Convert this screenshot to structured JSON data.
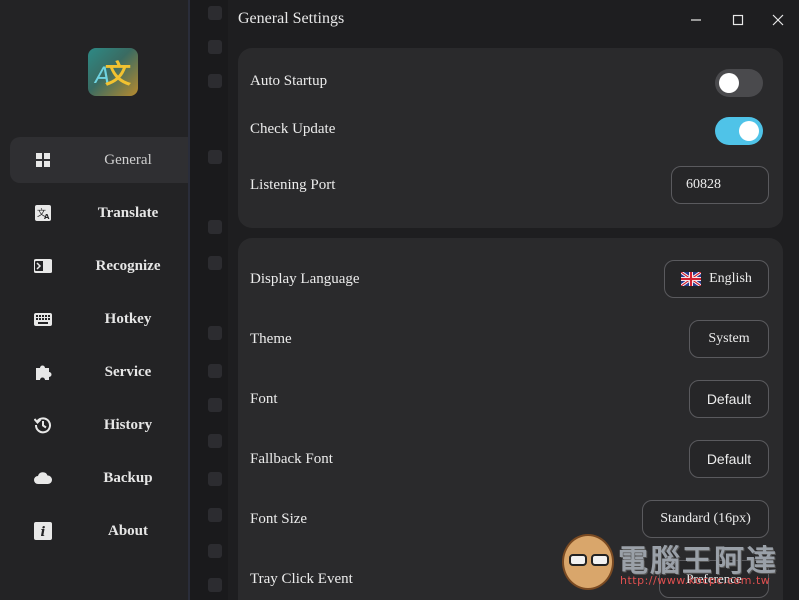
{
  "window": {
    "title": "General Settings"
  },
  "sidebar": {
    "items": [
      {
        "label": "General",
        "icon": "grid-icon",
        "active": true
      },
      {
        "label": "Translate",
        "icon": "translate-icon"
      },
      {
        "label": "Recognize",
        "icon": "recognize-icon"
      },
      {
        "label": "Hotkey",
        "icon": "keyboard-icon"
      },
      {
        "label": "Service",
        "icon": "puzzle-icon"
      },
      {
        "label": "History",
        "icon": "history-icon"
      },
      {
        "label": "Backup",
        "icon": "cloud-icon"
      },
      {
        "label": "About",
        "icon": "info-icon"
      }
    ]
  },
  "app": {
    "startup": {
      "label": "Auto Startup",
      "enabled": false
    },
    "update": {
      "label": "Check Update",
      "enabled": true
    },
    "port": {
      "label": "Listening Port",
      "value": "60828"
    }
  },
  "appearance": {
    "language": {
      "label": "Display Language",
      "value": "English"
    },
    "theme": {
      "label": "Theme",
      "value": "System"
    },
    "font": {
      "label": "Font",
      "value": "Default"
    },
    "fallback_font": {
      "label": "Fallback Font",
      "value": "Default"
    },
    "font_size": {
      "label": "Font Size",
      "value": "Standard (16px)"
    },
    "tray_click": {
      "label": "Tray Click Event",
      "value": "Preference"
    }
  },
  "colors": {
    "accent": "#4fc3e8",
    "card": "#2a2a2c",
    "sidebar": "#232325"
  },
  "watermark": {
    "text": "電腦王阿達",
    "url": "http://www.kocpc.com.tw"
  }
}
